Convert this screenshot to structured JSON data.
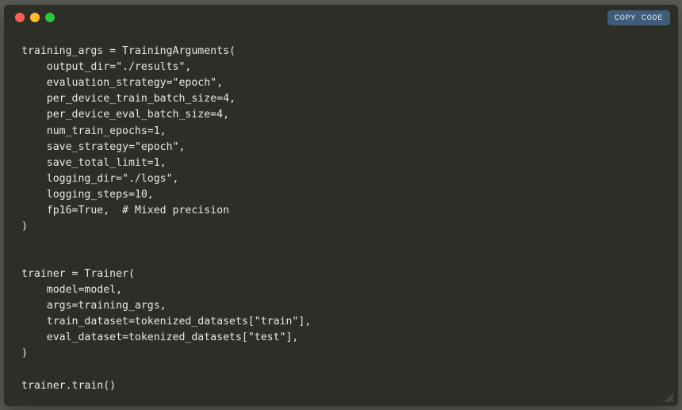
{
  "titlebar": {
    "copy_label": "COPY CODE"
  },
  "code": {
    "lines": [
      "training_args = TrainingArguments(",
      "    output_dir=\"./results\",",
      "    evaluation_strategy=\"epoch\",",
      "    per_device_train_batch_size=4,",
      "    per_device_eval_batch_size=4,",
      "    num_train_epochs=1,",
      "    save_strategy=\"epoch\",",
      "    save_total_limit=1,",
      "    logging_dir=\"./logs\",",
      "    logging_steps=10,",
      "    fp16=True,  # Mixed precision",
      ")",
      "",
      "",
      "trainer = Trainer(",
      "    model=model,",
      "    args=training_args,",
      "    train_dataset=tokenized_datasets[\"train\"],",
      "    eval_dataset=tokenized_datasets[\"test\"],",
      ")",
      "",
      "trainer.train()"
    ]
  }
}
